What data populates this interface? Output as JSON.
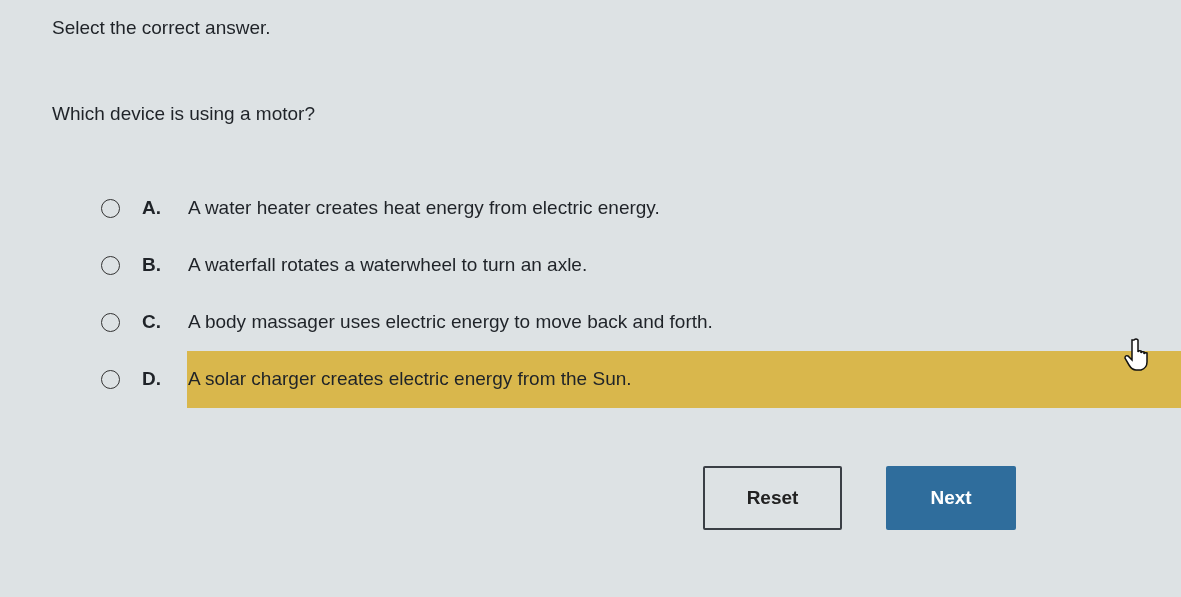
{
  "instruction": "Select the correct answer.",
  "question": "Which device is using a motor?",
  "options": [
    {
      "letter": "A.",
      "text": "A water heater creates heat energy from electric energy.",
      "selected": false,
      "hovered": false
    },
    {
      "letter": "B.",
      "text": "A waterfall rotates a waterwheel to turn an axle.",
      "selected": false,
      "hovered": false
    },
    {
      "letter": "C.",
      "text": "A body massager uses electric energy to move back and forth.",
      "selected": false,
      "hovered": false
    },
    {
      "letter": "D.",
      "text": "A solar charger creates electric energy from the Sun.",
      "selected": false,
      "hovered": true
    }
  ],
  "buttons": [
    {
      "kind": "outline",
      "label": "Reset"
    },
    {
      "kind": "primary",
      "label": "Next"
    }
  ]
}
